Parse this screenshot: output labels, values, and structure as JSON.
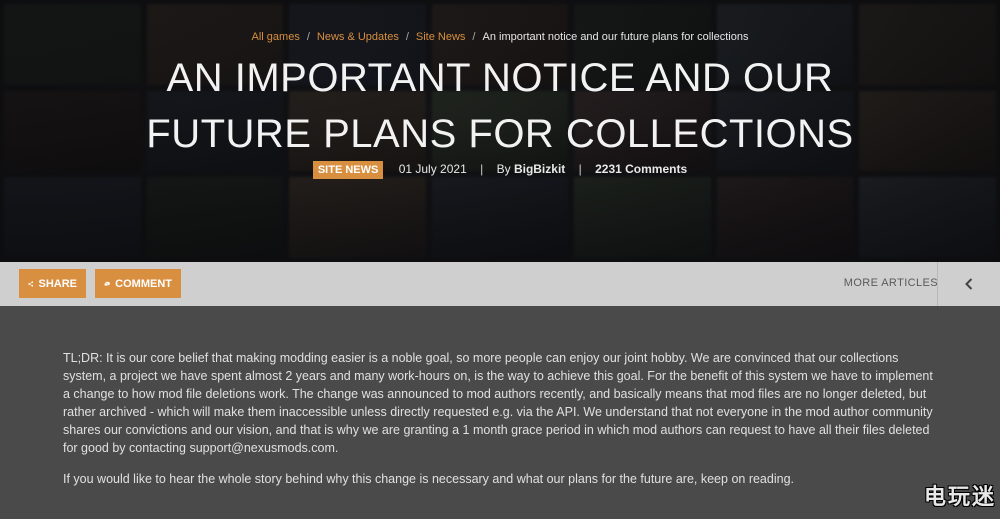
{
  "breadcrumb": {
    "items": [
      "All games",
      "News & Updates",
      "Site News"
    ],
    "separator": "/",
    "current": "An important notice and our future plans for collections"
  },
  "article": {
    "title": "AN IMPORTANT NOTICE AND OUR FUTURE PLANS FOR COLLECTIONS",
    "category_badge": "SITE NEWS",
    "date": "01 July 2021",
    "separator": "|",
    "by_prefix": "By",
    "author": "BigBizkit",
    "comments": "2231 Comments"
  },
  "actions": {
    "share_label": "SHARE",
    "comment_label": "COMMENT",
    "more_articles_label": "MORE ARTICLES"
  },
  "body": {
    "paragraph1": "TL;DR: It is our core belief that making modding easier is a noble goal, so more people can enjoy our joint hobby. We are convinced that our collections system, a project we have spent almost 2 years and many work-hours on, is the way to achieve this goal. For the benefit of this system we have to implement a change to how mod file deletions work. The change was announced to mod authors recently, and basically means that mod files are no longer deleted, but rather archived - which will make them inaccessible unless directly requested e.g. via the API. We understand that not everyone in the mod author community shares our convictions and our vision, and that is why we are granting a 1 month grace period in which mod authors can request to have all their files deleted for good by contacting support@nexusmods.com.",
    "paragraph2": "If you would like to hear the whole story behind why this change is necessary and what our plans for the future are, keep on reading."
  },
  "watermark": {
    "char1": "电",
    "char2": "玩",
    "char3": "迷"
  },
  "colors": {
    "accent": "#d98f40",
    "background": "#4a4a4a",
    "action_bar": "#cfcfcf"
  },
  "icons": {
    "share": "share-icon",
    "comment": "comment-bubble-icon",
    "back": "chevron-left-icon"
  }
}
